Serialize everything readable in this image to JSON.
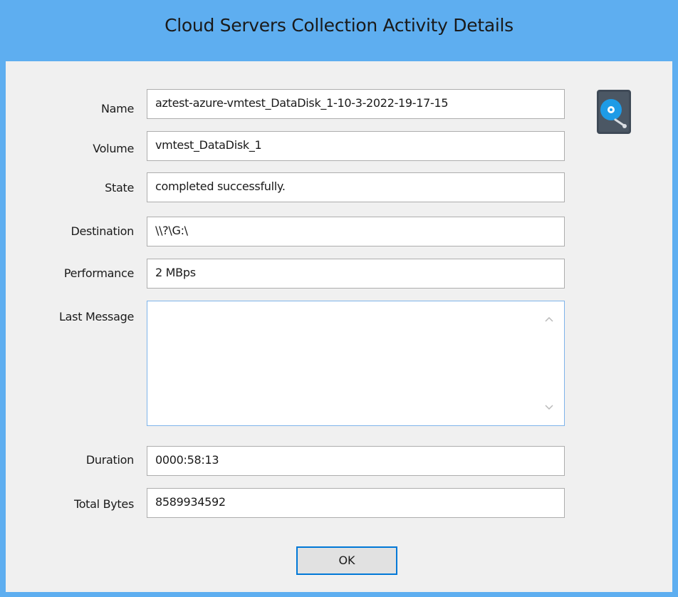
{
  "window": {
    "title": "Cloud Servers Collection Activity Details"
  },
  "fields": {
    "name": {
      "label": "Name",
      "value": "aztest-azure-vmtest_DataDisk_1-10-3-2022-19-17-15"
    },
    "volume": {
      "label": "Volume",
      "value": "vmtest_DataDisk_1"
    },
    "state": {
      "label": "State",
      "value": "completed successfully."
    },
    "destination": {
      "label": "Destination",
      "value": "\\\\?\\G:\\"
    },
    "performance": {
      "label": "Performance",
      "value": "2 MBps"
    },
    "last_message": {
      "label": "Last Message",
      "value": ""
    },
    "duration": {
      "label": "Duration",
      "value": "0000:58:13"
    },
    "total_bytes": {
      "label": "Total Bytes",
      "value": "8589934592"
    }
  },
  "buttons": {
    "ok_label": "OK"
  },
  "icons": {
    "header": "hard-disk-icon"
  },
  "colors": {
    "window_frame": "#5eaef0",
    "client_bg": "#f0f0f0",
    "button_focus": "#0078d7",
    "disk_icon_bg": "#3f4a57",
    "disk_icon_platter": "#1e9be6"
  }
}
